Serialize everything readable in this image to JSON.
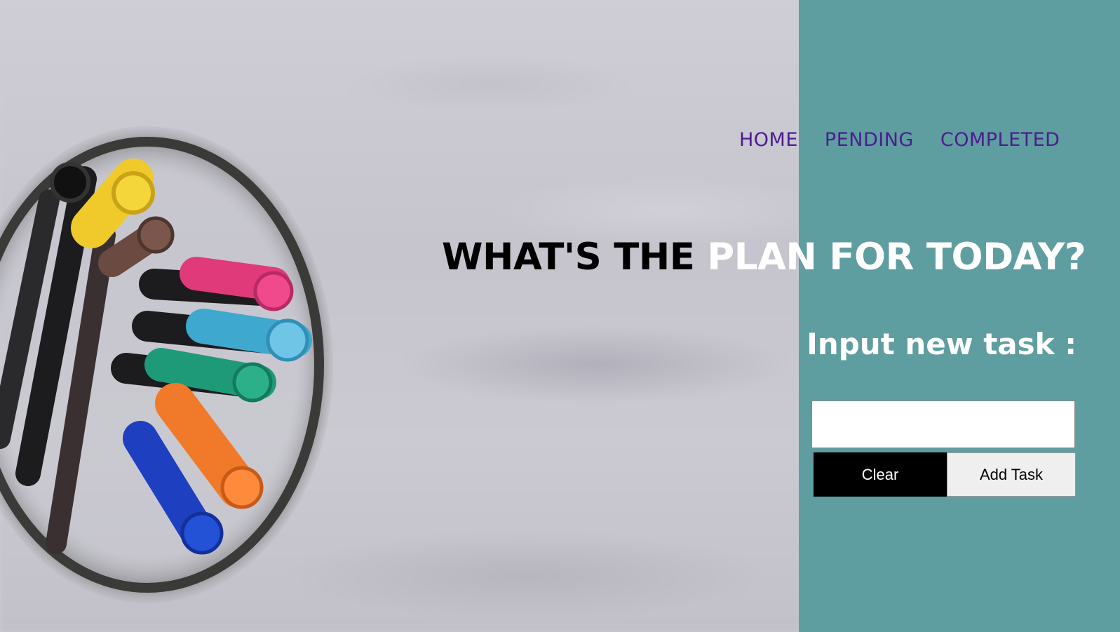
{
  "nav": {
    "home": "HOME",
    "pending": "PENDING",
    "completed": "COMPLETED"
  },
  "headline": {
    "part1": "WHAT'S THE ",
    "part2": "PLAN FOR TODAY?"
  },
  "form": {
    "label": "Input new task :",
    "input_value": "",
    "clear_label": "Clear",
    "add_label": "Add Task"
  },
  "colors": {
    "panel": "#5f9ea0",
    "nav_link": "#4b1d8f",
    "headline_dark": "#000000",
    "headline_light": "#ffffff"
  }
}
